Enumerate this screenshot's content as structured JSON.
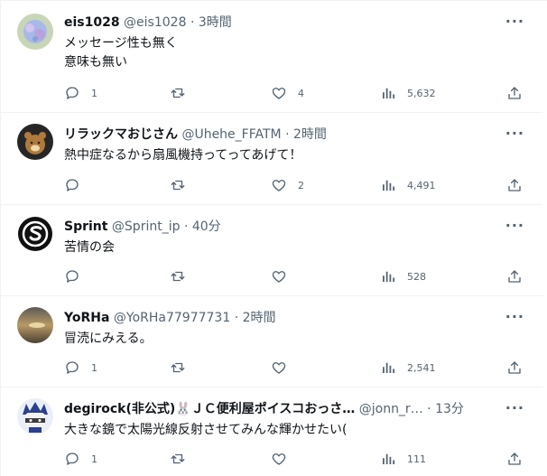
{
  "tweets": [
    {
      "name": "eis1028",
      "handle": "@eis1028",
      "time": "3時間",
      "text": "メッセージ性も無く\n意味も無い",
      "replies": "1",
      "retweets": "",
      "likes": "4",
      "views": "5,632",
      "avatar_color": "#b9c9a6"
    },
    {
      "name": "リラックマおじさん",
      "handle": "@Uhehe_FFATM",
      "time": "2時間",
      "text": "熱中症なるから扇風機持ってってあげて！",
      "replies": "",
      "retweets": "",
      "likes": "2",
      "views": "4,491",
      "avatar_color": "#2b2b2b"
    },
    {
      "name": "Sprint",
      "handle": "@Sprint_ip",
      "time": "40分",
      "text": "苦情の会",
      "replies": "",
      "retweets": "",
      "likes": "",
      "views": "528",
      "avatar_color": "#111111"
    },
    {
      "name": "YoRHa",
      "handle": "@YoRHa77977731",
      "time": "2時間",
      "text": "冒涜にみえる。",
      "replies": "1",
      "retweets": "",
      "likes": "",
      "views": "2,541",
      "avatar_color": "#7a6f58"
    },
    {
      "name": "degirock(非公式)🐰ＪＣ便利屋ポイスコおっさ…",
      "handle": "@jonn_r…",
      "time": "13分",
      "text": "大きな鏡で太陽光線反射させてみんな輝かせたい(",
      "replies": "1",
      "retweets": "",
      "likes": "",
      "views": "111",
      "avatar_color": "#3a4a8a"
    }
  ],
  "separator": "·",
  "icons": {
    "reply": "reply-icon",
    "retweet": "retweet-icon",
    "like": "heart-icon",
    "views": "views-icon",
    "share": "share-icon",
    "more": "more-icon"
  }
}
